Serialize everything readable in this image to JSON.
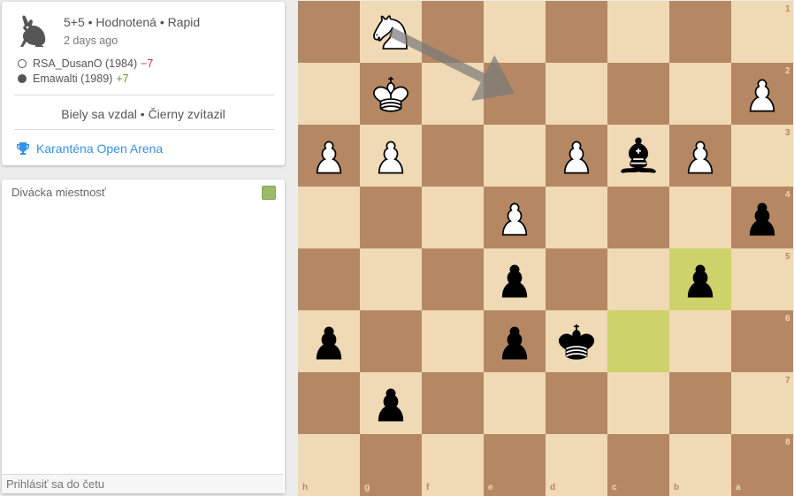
{
  "game": {
    "setup": "5+5 • Hodnotená • Rapid",
    "date": "2 days ago",
    "players": [
      {
        "color": "white",
        "name": "RSA_DusanO (1984)",
        "diff": "−7"
      },
      {
        "color": "black",
        "name": "Emawalti (1989)",
        "diff": "+7"
      }
    ],
    "result": "Biely sa vzdal • Čierny zvítazil",
    "tournament": "Karanténa Open Arena",
    "speed_icon": "rabbit-icon",
    "tournament_icon": "trophy-icon"
  },
  "chat": {
    "title": "Divácka miestnosť",
    "input_placeholder": "Prihlásiť sa do četu"
  },
  "board": {
    "orientation": "black",
    "files_bottom": [
      "h",
      "g",
      "f",
      "e",
      "d",
      "c",
      "b",
      "a"
    ],
    "ranks_right": [
      "1",
      "2",
      "3",
      "4",
      "5",
      "6",
      "7",
      "8"
    ],
    "highlight_squares": [
      "b5",
      "c6"
    ],
    "arrow": {
      "from": "g1",
      "to": "e2",
      "color": "#7a7a7a"
    },
    "pieces": [
      {
        "square": "g1",
        "type": "knight",
        "color": "white"
      },
      {
        "square": "g2",
        "type": "king",
        "color": "white"
      },
      {
        "square": "a2",
        "type": "pawn",
        "color": "white"
      },
      {
        "square": "h3",
        "type": "pawn",
        "color": "white"
      },
      {
        "square": "g3",
        "type": "pawn",
        "color": "white"
      },
      {
        "square": "d3",
        "type": "pawn",
        "color": "white"
      },
      {
        "square": "c3",
        "type": "bishop",
        "color": "black"
      },
      {
        "square": "b3",
        "type": "pawn",
        "color": "white"
      },
      {
        "square": "e4",
        "type": "pawn",
        "color": "white"
      },
      {
        "square": "a4",
        "type": "pawn",
        "color": "black"
      },
      {
        "square": "e5",
        "type": "pawn",
        "color": "black"
      },
      {
        "square": "b5",
        "type": "pawn",
        "color": "black"
      },
      {
        "square": "h6",
        "type": "pawn",
        "color": "black"
      },
      {
        "square": "e6",
        "type": "pawn",
        "color": "black"
      },
      {
        "square": "d6",
        "type": "king",
        "color": "black"
      },
      {
        "square": "g7",
        "type": "pawn",
        "color": "black"
      }
    ]
  }
}
